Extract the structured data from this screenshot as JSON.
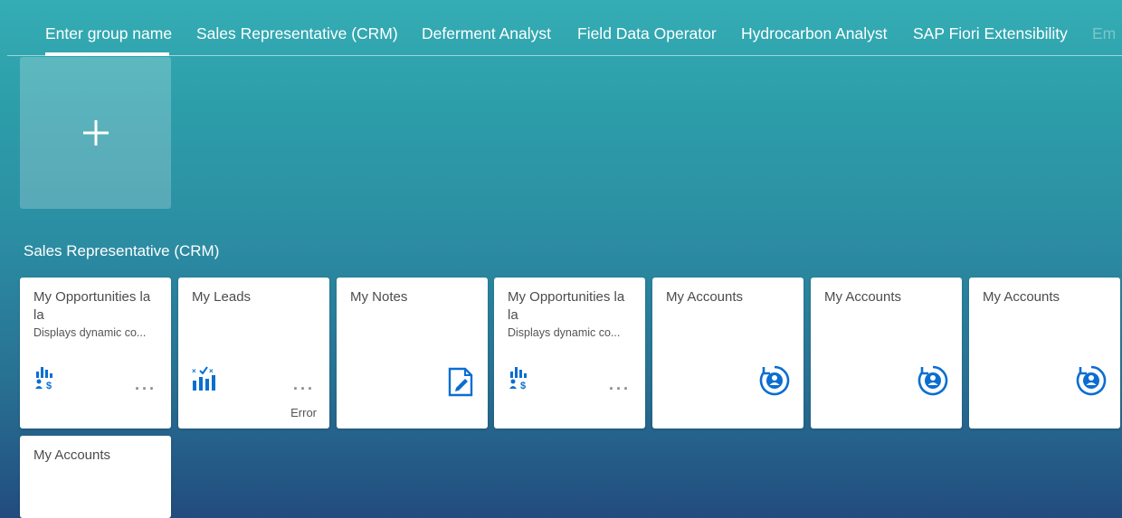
{
  "tabs": [
    {
      "label": "Enter group name"
    },
    {
      "label": "Sales Representative (CRM)"
    },
    {
      "label": "Deferment Analyst"
    },
    {
      "label": "Field Data Operator"
    },
    {
      "label": "Hydrocarbon Analyst"
    },
    {
      "label": "SAP Fiori Extensibility"
    },
    {
      "label": "Em"
    }
  ],
  "add_tile": {
    "icon": "plus-icon"
  },
  "group": {
    "title": "Sales Representative (CRM)"
  },
  "tiles": [
    {
      "title": "My Opportunities la la",
      "subtitle": "Displays dynamic co...",
      "icon": "opportunity-icon",
      "more": "...",
      "status": ""
    },
    {
      "title": "My Leads",
      "subtitle": "",
      "icon": "leads-chart-icon",
      "more": "...",
      "status": "Error"
    },
    {
      "title": "My Notes",
      "subtitle": "",
      "icon": "notes-icon",
      "more": "",
      "status": ""
    },
    {
      "title": "My Opportunities la la",
      "subtitle": "Displays dynamic co...",
      "icon": "opportunity-icon",
      "more": "...",
      "status": ""
    },
    {
      "title": "My Accounts",
      "subtitle": "",
      "icon": "account-icon",
      "more": "",
      "status": ""
    },
    {
      "title": "My Accounts",
      "subtitle": "",
      "icon": "account-icon",
      "more": "",
      "status": ""
    },
    {
      "title": "My Accounts",
      "subtitle": "",
      "icon": "account-icon",
      "more": "",
      "status": ""
    },
    {
      "title": "My Accounts",
      "subtitle": "",
      "icon": "account-icon",
      "more": "",
      "status": ""
    }
  ],
  "colors": {
    "icon_blue": "#0a6ed1",
    "tile_bg": "#ffffff",
    "bg_top": "#35adb5",
    "bg_bottom": "#224c7e"
  }
}
